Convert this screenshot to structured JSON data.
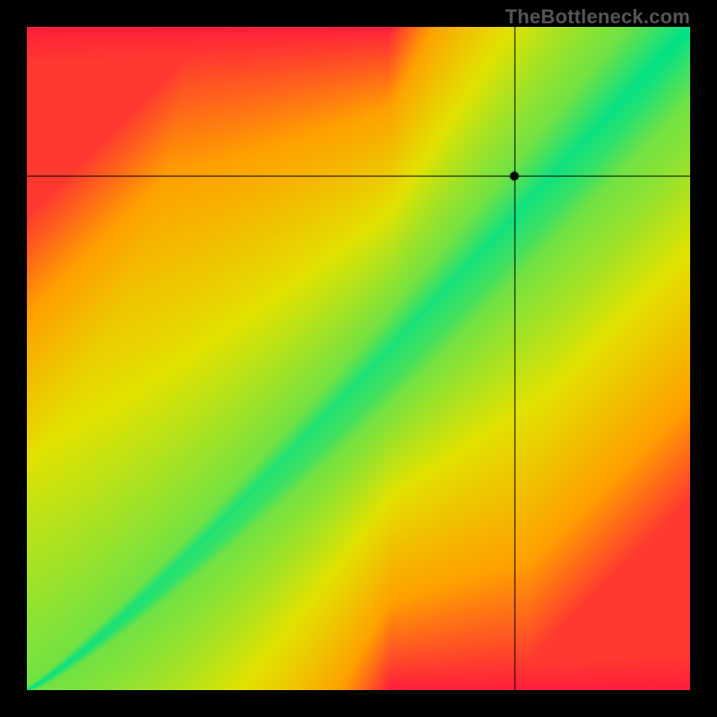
{
  "watermark": "TheBottleneck.com",
  "chart_data": {
    "type": "heatmap",
    "title": "",
    "xlabel": "",
    "ylabel": "",
    "xlim": [
      0,
      1
    ],
    "ylim": [
      0,
      1
    ],
    "grid": false,
    "legend_position": "none",
    "crosshair": {
      "x": 0.735,
      "y": 0.775
    },
    "marker": {
      "x": 0.735,
      "y": 0.775
    },
    "optimum_ratio": 1.0,
    "curve_exponent": 1.15,
    "tolerance_narrow_at_origin": 0.005,
    "tolerance_wide_at_max": 0.11,
    "colors": {
      "good": "#00E187",
      "mid_high": "#E2E200",
      "mid_low": "#FFA000",
      "bad": "#FF1E3C"
    },
    "description": "Diagonal 'good/green' band widening toward upper-right; orange/red away from diagonal. Black crosshair and dot at the marked point."
  }
}
